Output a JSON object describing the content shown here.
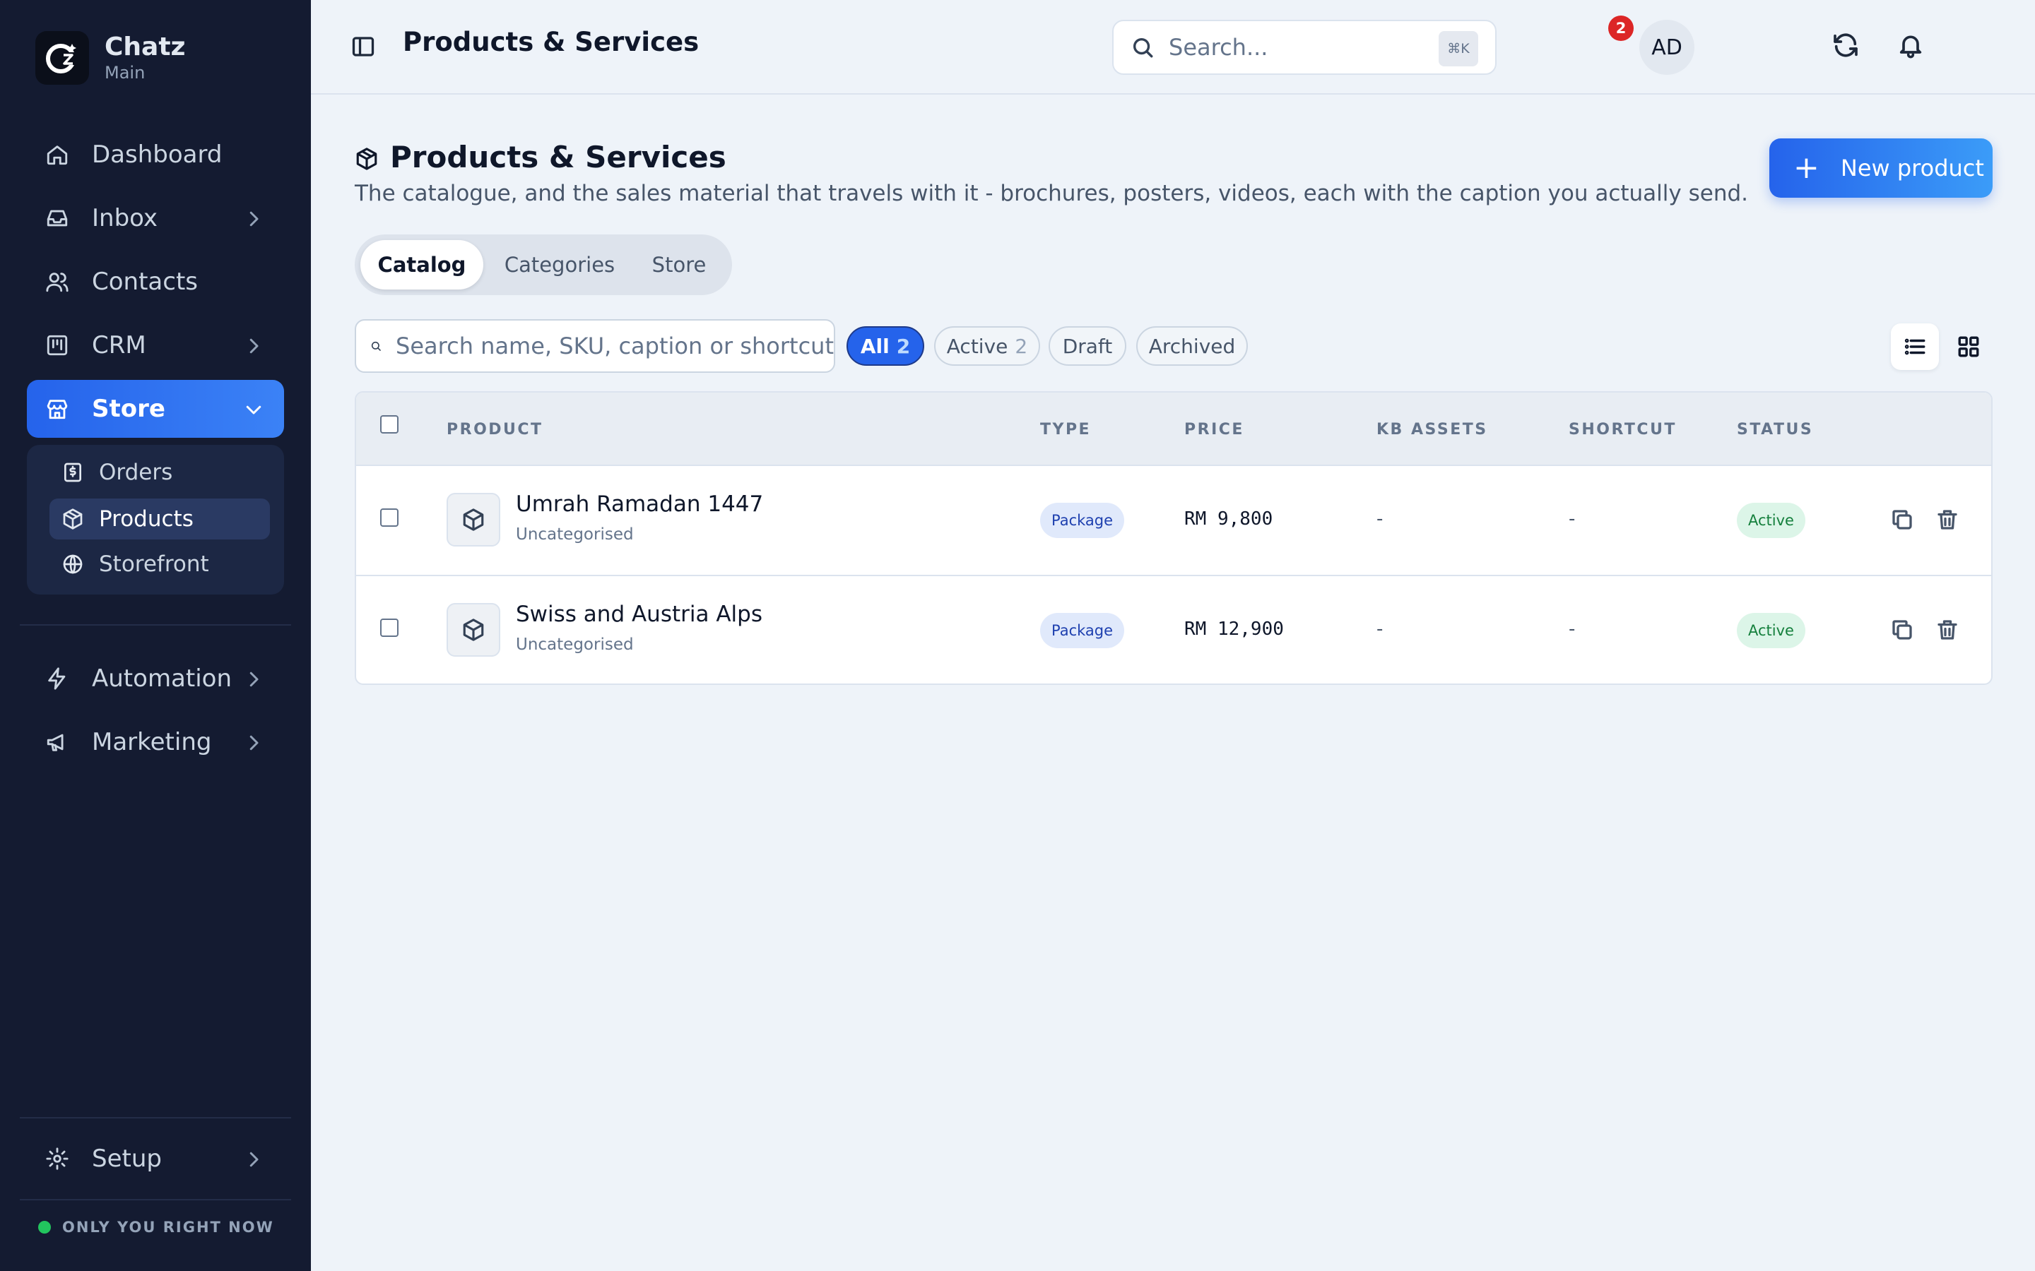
{
  "brand": {
    "name": "Chatz",
    "workspace": "Main"
  },
  "sidebar": {
    "items": [
      {
        "label": "Dashboard",
        "icon": "home-icon"
      },
      {
        "label": "Inbox",
        "icon": "inbox-icon"
      },
      {
        "label": "Contacts",
        "icon": "users-icon"
      },
      {
        "label": "CRM",
        "icon": "kanban-icon"
      },
      {
        "label": "Store",
        "icon": "store-icon",
        "active": true
      },
      {
        "label": "Automation",
        "icon": "lightning-icon"
      },
      {
        "label": "Marketing",
        "icon": "megaphone-icon"
      }
    ],
    "store_sub": [
      {
        "label": "Orders",
        "icon": "receipt-icon"
      },
      {
        "label": "Products",
        "icon": "box-icon",
        "active": true
      },
      {
        "label": "Storefront",
        "icon": "globe-icon"
      }
    ],
    "setup": "Setup",
    "presence": "ONLY YOU RIGHT NOW"
  },
  "topbar": {
    "title": "Products & Services",
    "search_placeholder": "Search...",
    "search_shortcut": "⌘K",
    "notification_count": "2",
    "avatar_initials": "AD"
  },
  "page": {
    "title": "Products & Services",
    "description": "The catalogue, and the sales material that travels with it - brochures, posters, videos, each with the caption you actually send.",
    "new_button": "New product",
    "tabs": [
      "Catalog",
      "Categories",
      "Store"
    ],
    "active_tab": "Catalog"
  },
  "filters": {
    "search_placeholder": "Search name, SKU, caption or shortcut",
    "chips": [
      {
        "label": "All",
        "count": "2",
        "active": true
      },
      {
        "label": "Active",
        "count": "2"
      },
      {
        "label": "Draft",
        "count": ""
      },
      {
        "label": "Archived",
        "count": ""
      }
    ],
    "view_modes": [
      "list-view",
      "grid-view"
    ],
    "active_view": "list-view"
  },
  "table": {
    "columns": [
      "PRODUCT",
      "TYPE",
      "PRICE",
      "KB ASSETS",
      "SHORTCUT",
      "STATUS"
    ],
    "rows": [
      {
        "name": "Umrah Ramadan 1447",
        "category": "Uncategorised",
        "type": "Package",
        "price": "RM 9,800",
        "kb_assets": "-",
        "shortcut": "-",
        "status": "Active"
      },
      {
        "name": "Swiss and Austria Alps",
        "category": "Uncategorised",
        "type": "Package",
        "price": "RM 12,900",
        "kb_assets": "-",
        "shortcut": "-",
        "status": "Active"
      }
    ]
  },
  "colors": {
    "sidebar_bg": "#141b31",
    "accent": "#2563eb",
    "active_status": "#15803d",
    "badge": "#dc2626"
  }
}
